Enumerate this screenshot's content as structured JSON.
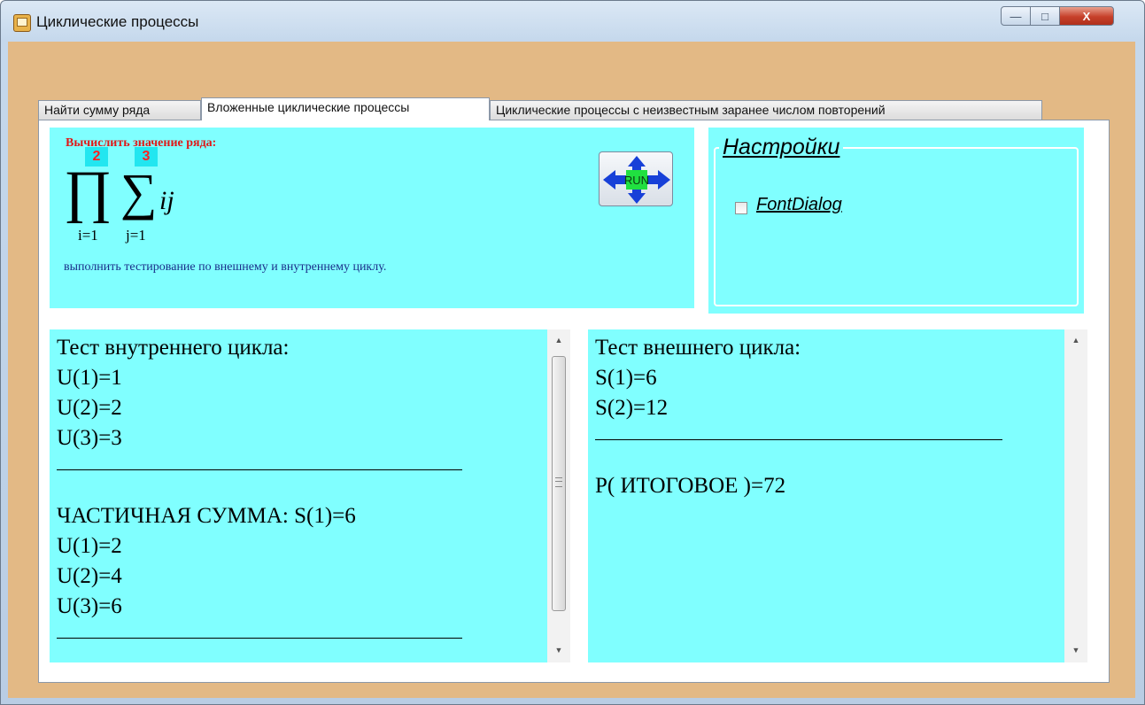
{
  "window": {
    "title": "Циклические процессы",
    "app_icon": "app-icon",
    "controls": {
      "minimize": "—",
      "maximize": "□",
      "close": "X"
    }
  },
  "tabs": [
    {
      "label": "Найти сумму ряда",
      "active": false
    },
    {
      "label": "Вложенные циклические процессы",
      "active": true
    },
    {
      "label": "Циклические процессы с неизвестным заранее числом повторений",
      "active": false
    }
  ],
  "task": {
    "title": "Вычислить значение ряда:",
    "outer_upper": "2",
    "inner_upper": "3",
    "outer_lower": "i=1",
    "inner_lower": "j=1",
    "expression": "ij",
    "description": "выполнить тестирование по внешнему и внутреннему циклу.",
    "run_button_label": "RUN"
  },
  "settings": {
    "legend": "Настройки",
    "fontdialog_label": "FontDialog",
    "fontdialog_checked": false
  },
  "inner_test": {
    "lines": [
      "Тест  внутреннего  цикла:",
      "U(1)=1",
      "U(2)=2",
      "U(3)=3",
      "",
      "  ЧАСТИЧНАЯ  СУММА: S(1)=6",
      "U(1)=2",
      "U(2)=4",
      "U(3)=6",
      ""
    ]
  },
  "outer_test": {
    "lines": [
      "Тест  внешнего  цикла:",
      "S(1)=6",
      "S(2)=12",
      "",
      "P( ИТОГОВОЕ )=72"
    ]
  },
  "colors": {
    "panel_bg": "#80ffff",
    "form_bg": "#e3b985",
    "task_title": "#e01818",
    "task_desc": "#1a2f8a"
  }
}
